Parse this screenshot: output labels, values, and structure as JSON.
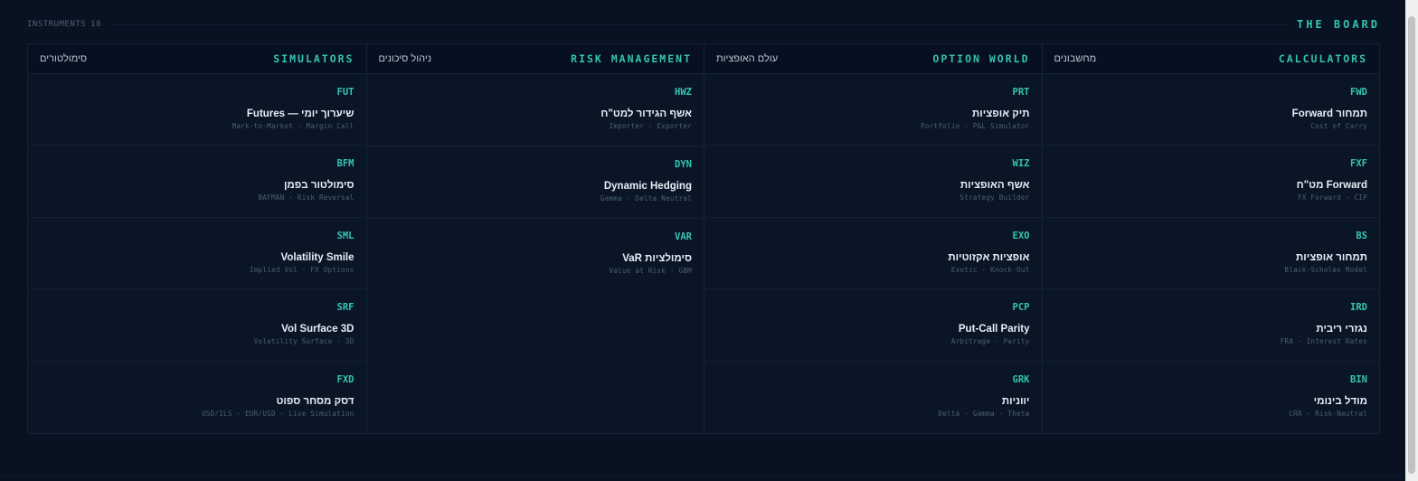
{
  "header": {
    "count_label": "INSTRUMENTS",
    "count_value": "18",
    "board_title": "THE BOARD"
  },
  "columns": [
    {
      "title_en": "CALCULATORS",
      "title_he": "מחשבונים",
      "cards": [
        {
          "code": "FWD",
          "title": "תמחור Forward",
          "sub": "Cost of Carry"
        },
        {
          "code": "FXF",
          "title": "Forward מט\"ח",
          "sub": "FX Forward · CIP"
        },
        {
          "code": "BS",
          "title": "תמחור אופציות",
          "sub": "Black-Scholes Model"
        },
        {
          "code": "IRD",
          "title": "נגזרי ריבית",
          "sub": "FRA · Interest Rates"
        },
        {
          "code": "BIN",
          "title": "מודל בינומי",
          "sub": "CRR · Risk-Neutral"
        }
      ]
    },
    {
      "title_en": "OPTION WORLD",
      "title_he": "עולם האופציות",
      "cards": [
        {
          "code": "PRT",
          "title": "תיק אופציות",
          "sub": "Portfolio · P&L Simulator"
        },
        {
          "code": "WIZ",
          "title": "אשף האופציות",
          "sub": "Strategy Builder"
        },
        {
          "code": "EXO",
          "title": "אופציות אקזוטיות",
          "sub": "Exotic · Knock-Out"
        },
        {
          "code": "PCP",
          "title": "Put-Call Parity",
          "sub": "Arbitrage · Parity"
        },
        {
          "code": "GRK",
          "title": "יווניות",
          "sub": "Delta · Gamma · Theta"
        }
      ]
    },
    {
      "title_en": "RISK MANAGEMENT",
      "title_he": "ניהול סיכונים",
      "cards": [
        {
          "code": "HWZ",
          "title": "אשף הגידור למט\"ח",
          "sub": "Importer · Exporter"
        },
        {
          "code": "DYN",
          "title": "Dynamic Hedging",
          "sub": "Gamma · Delta Neutral"
        },
        {
          "code": "VAR",
          "title": "סימולציות VaR",
          "sub": "Value at Risk · GBM"
        }
      ]
    },
    {
      "title_en": "SIMULATORS",
      "title_he": "סימולטורים",
      "cards": [
        {
          "code": "FUT",
          "title": "שיערוך יומי — Futures",
          "sub": "Mark-to-Market · Margin Call"
        },
        {
          "code": "BFM",
          "title": "סימולטור בפמן",
          "sub": "BAFMAN · Risk Reversal"
        },
        {
          "code": "SML",
          "title": "Volatility Smile",
          "sub": "Implied Vol · FX Options"
        },
        {
          "code": "SRF",
          "title": "Vol Surface 3D",
          "sub": "Volatility Surface · 3D"
        },
        {
          "code": "FXD",
          "title": "דסק מסחר ספוט",
          "sub": "USD/ILS · EUR/USD · Live Simulation"
        }
      ]
    }
  ]
}
